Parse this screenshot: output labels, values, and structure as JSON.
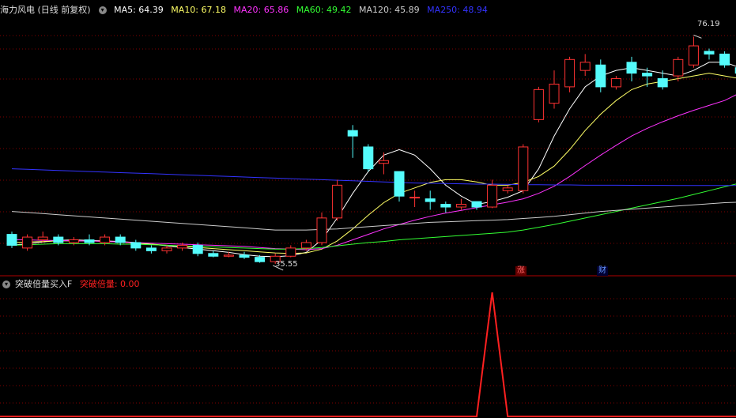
{
  "main": {
    "title": "海力风电 (日线 前复权)",
    "ma": [
      {
        "label": "MA5: 64.39",
        "color": "#ffffff"
      },
      {
        "label": "MA10: 67.18",
        "color": "#ffff66"
      },
      {
        "label": "MA20: 65.86",
        "color": "#ff33ff"
      },
      {
        "label": "MA60: 49.42",
        "color": "#33ff33"
      },
      {
        "label": "MA120: 45.89",
        "color": "#cccccc"
      },
      {
        "label": "MA250: 48.94",
        "color": "#3333ff"
      }
    ],
    "high_label": "76.19",
    "low_label": "35.55",
    "tag_zhang": "涨",
    "tag_cai": "财"
  },
  "sub": {
    "title": "突破倍量买入F",
    "value_label": "突破倍量: 0.00"
  },
  "chart_data": {
    "type": "candlestick",
    "candles": [
      [
        40.0,
        38.0,
        40.5,
        37.5
      ],
      [
        37.5,
        39.5,
        40.0,
        37.0
      ],
      [
        39.0,
        39.5,
        40.5,
        38.5
      ],
      [
        39.5,
        38.5,
        40.0,
        38.0
      ],
      [
        38.5,
        39.0,
        39.5,
        38.0
      ],
      [
        39.0,
        38.5,
        40.0,
        38.0
      ],
      [
        38.5,
        39.5,
        40.0,
        38.0
      ],
      [
        39.5,
        38.5,
        40.0,
        38.0
      ],
      [
        38.5,
        37.5,
        39.0,
        37.0
      ],
      [
        37.5,
        37.0,
        38.0,
        36.5
      ],
      [
        37.0,
        37.5,
        38.0,
        36.5
      ],
      [
        37.5,
        38.0,
        38.5,
        37.0
      ],
      [
        38.0,
        36.5,
        38.5,
        36.0
      ],
      [
        36.5,
        36.0,
        37.0,
        35.8
      ],
      [
        36.0,
        36.2,
        36.8,
        35.8
      ],
      [
        36.2,
        35.8,
        36.8,
        35.5
      ],
      [
        35.8,
        35.0,
        36.2,
        34.8
      ],
      [
        35.0,
        36.0,
        36.5,
        34.6
      ],
      [
        36.0,
        37.5,
        38.0,
        35.8
      ],
      [
        37.5,
        38.5,
        39.0,
        37.0
      ],
      [
        38.5,
        43.0,
        44.0,
        38.0
      ],
      [
        43.0,
        49.0,
        50.0,
        42.5
      ],
      [
        59.0,
        58.0,
        60.0,
        54.0
      ],
      [
        56.0,
        52.0,
        56.5,
        51.5
      ],
      [
        53.0,
        53.5,
        55.0,
        51.0
      ],
      [
        51.5,
        47.0,
        51.5,
        46.0
      ],
      [
        46.8,
        46.8,
        48.0,
        45.0
      ],
      [
        46.5,
        46.0,
        48.0,
        44.5
      ],
      [
        45.5,
        45.0,
        46.0,
        44.0
      ],
      [
        45.0,
        45.5,
        46.5,
        44.5
      ],
      [
        46.0,
        45.0,
        46.0,
        44.5
      ],
      [
        45.0,
        49.0,
        50.0,
        44.8
      ],
      [
        48.0,
        48.5,
        49.0,
        47.5
      ],
      [
        48.0,
        56.0,
        56.5,
        47.5
      ],
      [
        61.0,
        66.5,
        67.0,
        60.5
      ],
      [
        64.0,
        67.5,
        70.0,
        63.0
      ],
      [
        67.0,
        72.0,
        72.5,
        66.0
      ],
      [
        70.0,
        71.5,
        73.0,
        69.0
      ],
      [
        71.0,
        67.0,
        72.0,
        66.0
      ],
      [
        67.0,
        68.5,
        69.0,
        66.5
      ],
      [
        71.5,
        69.5,
        72.5,
        68.0
      ],
      [
        69.5,
        69.0,
        70.5,
        67.0
      ],
      [
        68.5,
        67.0,
        70.0,
        66.5
      ],
      [
        69.0,
        72.0,
        72.5,
        68.0
      ],
      [
        71.0,
        74.5,
        76.19,
        70.5
      ],
      [
        73.5,
        73.0,
        74.0,
        72.0
      ],
      [
        73.0,
        71.0,
        73.5,
        70.5
      ],
      [
        70.5,
        69.5,
        71.5,
        69.0
      ]
    ],
    "ma_series": {
      "MA5": [
        38.0,
        38.3,
        38.6,
        38.9,
        39.0,
        38.9,
        38.8,
        38.7,
        38.5,
        38.2,
        37.9,
        37.6,
        37.3,
        37.0,
        36.7,
        36.3,
        36.0,
        35.9,
        36.1,
        36.7,
        39.0,
        43.0,
        47.5,
        51.5,
        54.5,
        55.5,
        54.5,
        52.0,
        49.0,
        47.0,
        45.5,
        46.0,
        46.8,
        48.0,
        52.0,
        58.0,
        63.0,
        67.0,
        69.0,
        70.0,
        70.5,
        70.0,
        69.5,
        69.0,
        70.0,
        71.5,
        71.5,
        70.5
      ],
      "MA10": [
        38.5,
        38.6,
        38.7,
        38.8,
        38.8,
        38.8,
        38.7,
        38.6,
        38.4,
        38.2,
        38.0,
        37.8,
        37.6,
        37.4,
        37.2,
        37.0,
        36.8,
        36.6,
        36.5,
        36.6,
        37.3,
        38.8,
        41.0,
        43.5,
        45.8,
        47.5,
        48.5,
        49.5,
        50.0,
        50.0,
        49.6,
        49.0,
        49.0,
        49.5,
        50.6,
        52.5,
        55.5,
        59.0,
        62.0,
        64.5,
        66.5,
        67.5,
        68.0,
        68.5,
        69.0,
        69.5,
        69.0,
        68.5
      ],
      "MA20": [
        39.0,
        39.0,
        38.9,
        38.9,
        38.8,
        38.8,
        38.7,
        38.6,
        38.5,
        38.4,
        38.3,
        38.2,
        38.1,
        38.0,
        37.9,
        37.8,
        37.6,
        37.4,
        37.3,
        37.2,
        37.4,
        38.0,
        39.0,
        40.0,
        41.0,
        41.8,
        42.6,
        43.3,
        43.9,
        44.4,
        44.9,
        45.4,
        45.9,
        46.5,
        47.5,
        48.8,
        50.6,
        52.6,
        54.5,
        56.3,
        58.0,
        59.4,
        60.6,
        61.7,
        62.7,
        63.6,
        64.5,
        65.9
      ],
      "MA60": [
        38.0,
        38.1,
        38.2,
        38.3,
        38.3,
        38.3,
        38.3,
        38.2,
        38.2,
        38.1,
        38.0,
        37.9,
        37.8,
        37.7,
        37.6,
        37.5,
        37.4,
        37.3,
        37.3,
        37.4,
        37.6,
        37.9,
        38.2,
        38.5,
        38.7,
        39.0,
        39.2,
        39.4,
        39.6,
        39.8,
        40.0,
        40.2,
        40.4,
        40.8,
        41.3,
        41.8,
        42.4,
        43.0,
        43.6,
        44.2,
        44.8,
        45.4,
        46.0,
        46.6,
        47.3,
        48.0,
        48.7,
        49.4
      ],
      "MA120": [
        44.2,
        44.0,
        43.8,
        43.6,
        43.4,
        43.2,
        43.0,
        42.8,
        42.6,
        42.4,
        42.2,
        42.0,
        41.8,
        41.6,
        41.4,
        41.2,
        41.0,
        40.8,
        40.8,
        40.8,
        40.9,
        41.0,
        41.2,
        41.4,
        41.6,
        41.8,
        42.0,
        42.2,
        42.3,
        42.4,
        42.5,
        42.6,
        42.7,
        42.9,
        43.1,
        43.3,
        43.6,
        43.9,
        44.2,
        44.4,
        44.6,
        44.8,
        45.0,
        45.2,
        45.4,
        45.6,
        45.8,
        45.9
      ],
      "MA250": [
        52.0,
        51.9,
        51.8,
        51.7,
        51.6,
        51.5,
        51.4,
        51.3,
        51.2,
        51.1,
        51.0,
        50.9,
        50.8,
        50.7,
        50.6,
        50.5,
        50.4,
        50.3,
        50.2,
        50.1,
        50.0,
        49.9,
        49.8,
        49.7,
        49.6,
        49.5,
        49.4,
        49.35,
        49.3,
        49.25,
        49.2,
        49.2,
        49.15,
        49.1,
        49.1,
        49.05,
        49.05,
        49.0,
        49.0,
        49.0,
        48.98,
        48.97,
        48.96,
        48.95,
        48.95,
        48.94,
        48.94,
        48.94
      ]
    },
    "indicator": [
      0,
      0,
      0,
      0,
      0,
      0,
      0,
      0,
      0,
      0,
      0,
      0,
      0,
      0,
      0,
      0,
      0,
      0,
      0,
      0,
      0,
      0,
      0,
      0,
      0,
      0,
      0,
      0,
      0,
      0,
      0,
      1,
      0,
      0,
      0,
      0,
      0,
      0,
      0,
      0,
      0,
      0,
      0,
      0,
      0,
      0,
      0,
      0
    ],
    "ylim": [
      33,
      80
    ],
    "colors": {
      "up": "#ff3232",
      "down": "#54fcfc",
      "grid": "#800000",
      "indicator": "#ff2020"
    }
  }
}
